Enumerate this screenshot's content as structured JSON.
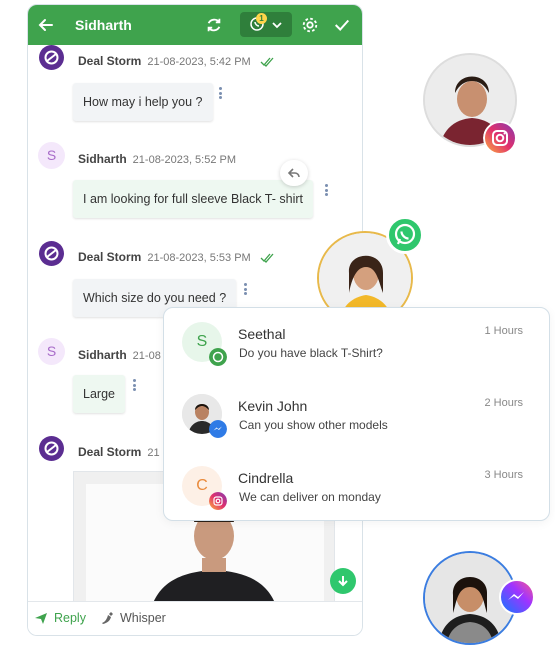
{
  "chat": {
    "contact_name": "Sidharth",
    "channel_badge_count": "1",
    "messages": [
      {
        "sender": "Deal Storm",
        "timestamp": "21-08-2023, 5:42 PM",
        "text": "How may i help you ?"
      },
      {
        "sender": "Sidharth",
        "timestamp": "21-08-2023, 5:52 PM",
        "text": "I am looking for full sleeve Black T- shirt"
      },
      {
        "sender": "Deal Storm",
        "timestamp": "21-08-2023, 5:53 PM",
        "text": "Which size do you need ?"
      },
      {
        "sender": "Sidharth",
        "timestamp": "21-08",
        "text": "Large"
      },
      {
        "sender": "Deal Storm",
        "timestamp": "21"
      }
    ],
    "avatar_initial": "S"
  },
  "composer": {
    "reply_label": "Reply",
    "whisper_label": "Whisper"
  },
  "inbox": {
    "conversations": [
      {
        "initial": "S",
        "name": "Seethal",
        "preview": "Do you have black T-Shirt?",
        "time": "1 Hours",
        "channel": "whatsapp-icon"
      },
      {
        "initial": "",
        "name": "Kevin John",
        "preview": "Can you show other models",
        "time": "2 Hours",
        "channel": "messenger-icon"
      },
      {
        "initial": "C",
        "name": "Cindrella",
        "preview": "We can deliver on monday",
        "time": "3 Hours",
        "channel": "instagram-icon"
      }
    ]
  },
  "colors": {
    "topbar": "#3fa34d",
    "brand_purple": "#5b2d91",
    "whatsapp": "#2fc76d",
    "messenger": "#3b7de0"
  }
}
